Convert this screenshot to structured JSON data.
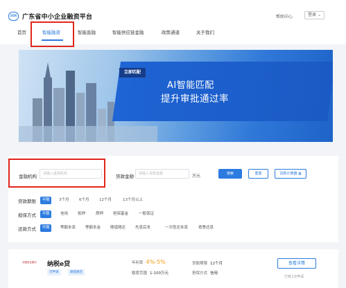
{
  "header": {
    "logo_text": "ZQX",
    "site_title": "广东省中小企业融资平台",
    "help_label": "帮助中心",
    "login_label": "登录 ⌄"
  },
  "nav": {
    "items": [
      {
        "label": "首页",
        "active": false
      },
      {
        "label": "智能融资",
        "active": true
      },
      {
        "label": "智能直融",
        "active": false
      },
      {
        "label": "智能供应链金融",
        "active": false
      },
      {
        "label": "政策通道",
        "active": false
      },
      {
        "label": "关于我们",
        "active": false
      }
    ]
  },
  "banner": {
    "tag": "立即匹配",
    "headline": "AI智能匹配",
    "subheadline": "提升审批通过率"
  },
  "filter": {
    "institution_label": "金融机构",
    "institution_placeholder": "请输入金融机构",
    "amount_label": "贷款金额",
    "amount_placeholder": "请输入贷款金额",
    "amount_unit": "万元",
    "search_label": "搜索",
    "reset_label": "重置",
    "calculator_label": "贷款计算器",
    "term": {
      "label": "贷款期限",
      "options": [
        "不限",
        "3个月",
        "6个月",
        "12个月",
        "13个月以上"
      ]
    },
    "guarantee": {
      "label": "担保方式",
      "options": [
        "不限",
        "信用",
        "抵押",
        "质押",
        "担保基金",
        "一般保证"
      ]
    },
    "repayment": {
      "label": "还款方式",
      "options": [
        "不限",
        "等额本息",
        "等额本金",
        "随借随还",
        "先息后本",
        "一次性还本息",
        "按季还息"
      ]
    }
  },
  "product": {
    "bank_name": "中国农业银行",
    "name": "纳税e贷",
    "tags": [
      "可申请",
      "随借随还"
    ],
    "rate_label": "年利率",
    "rate_value": "4%-5%",
    "limit_label": "额度范围",
    "limit_value": "1-100万元",
    "term_label": "贷款期限",
    "term_value": "12个月",
    "guarantee_label": "担保方式",
    "guarantee_value": "信用",
    "detail_button": "查看详情",
    "applied_text": "已有1次申请"
  },
  "colors": {
    "accent": "#2b7be0",
    "highlight_box": "#e0251b",
    "rate_orange": "#f39c12"
  }
}
